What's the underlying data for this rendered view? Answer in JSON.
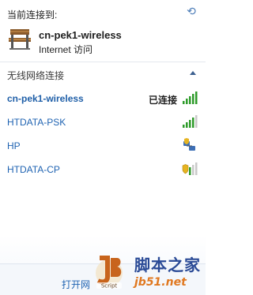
{
  "header": {
    "label": "当前连接到:",
    "refresh_icon": "refresh-icon"
  },
  "current": {
    "name": "cn-pek1-wireless",
    "status": "Internet 访问",
    "icon": "bench-icon"
  },
  "section": {
    "title": "无线网络连接",
    "collapse_icon": "chevron-up-icon"
  },
  "networks": [
    {
      "name": "cn-pek1-wireless",
      "status": "已连接",
      "signal": 5,
      "secured": false
    },
    {
      "name": "HTDATA-PSK",
      "status": "",
      "signal": 4,
      "secured": false
    },
    {
      "name": "HP",
      "status": "",
      "signal": 0,
      "secured": true,
      "type": "ad-hoc"
    },
    {
      "name": "HTDATA-CP",
      "status": "",
      "signal": 3,
      "secured": true
    }
  ],
  "footer": {
    "link": "打开网"
  },
  "watermark": {
    "logo_text": "Script",
    "title": "脚本之家",
    "url": "jb51.net"
  },
  "colors": {
    "signal_green": "#2e9b2a",
    "link_blue": "#1f63b2"
  }
}
